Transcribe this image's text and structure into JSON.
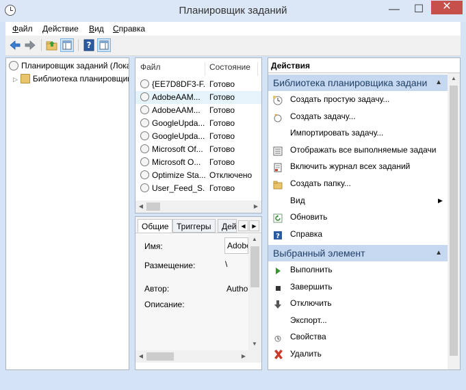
{
  "window": {
    "title": "Планировщик заданий",
    "minimize": "—",
    "maximize": "☐",
    "close": "✕",
    "app_icon": "clock-icon"
  },
  "menu": [
    "Файл",
    "Действие",
    "Вид",
    "Справка"
  ],
  "menu_underline": [
    "Ф",
    "Д",
    "В",
    "С"
  ],
  "menu_rest": [
    "айл",
    "ействие",
    "ид",
    "правка"
  ],
  "toolbar": {
    "icons": [
      "back-arrow-icon",
      "forward-arrow-icon",
      "folder-up-icon",
      "show-hide-tree-icon",
      "help-icon",
      "show-hide-action-pane-icon"
    ]
  },
  "tree": {
    "root": "Планировщик заданий (Локальный)",
    "child": "Библиотека планировщика заданий",
    "expander": "▷"
  },
  "tasks": {
    "col_file": "Файл",
    "col_status": "Состояние",
    "rows": [
      {
        "name": "{EE7D8DF3-F...",
        "status": "Готово"
      },
      {
        "name": "AdobeAAM...",
        "status": "Готово"
      },
      {
        "name": "AdobeAAM...",
        "status": "Готово"
      },
      {
        "name": "GoogleUpda...",
        "status": "Готово"
      },
      {
        "name": "GoogleUpda...",
        "status": "Готово"
      },
      {
        "name": "Microsoft Of...",
        "status": "Готово"
      },
      {
        "name": "Microsoft O...",
        "status": "Готово"
      },
      {
        "name": "Optimize Sta...",
        "status": "Отключено"
      },
      {
        "name": "User_Feed_S...",
        "status": "Готово"
      }
    ],
    "selected_index": 1
  },
  "details": {
    "tabs": [
      "Общие",
      "Триггеры",
      "Дей"
    ],
    "labels": [
      "Имя:",
      "Размещение:",
      "Автор:",
      "Описание:"
    ],
    "values": [
      "Adobe",
      "\\",
      "Autho",
      ""
    ],
    "nav_left": "◀",
    "nav_right": "▶"
  },
  "actions": {
    "header": "Действия",
    "section1": "Библиотека планировщика заданий",
    "section1_items": [
      {
        "label": "Создать простую задачу...",
        "icon": "create-basic-task-icon"
      },
      {
        "label": "Создать задачу...",
        "icon": "create-task-icon"
      },
      {
        "label": "Импортировать задачу...",
        "icon": ""
      },
      {
        "label": "Отображать все выполняемые задачи",
        "icon": "display-running-icon"
      },
      {
        "label": "Включить журнал всех заданий",
        "icon": "enable-history-icon"
      },
      {
        "label": "Создать папку...",
        "icon": "new-folder-icon"
      },
      {
        "label": "Вид",
        "icon": ""
      },
      {
        "label": "Обновить",
        "icon": "refresh-icon"
      },
      {
        "label": "Справка",
        "icon": "help-icon"
      }
    ],
    "section2": "Выбранный элемент",
    "section2_items": [
      {
        "label": "Выполнить",
        "icon": "run-icon"
      },
      {
        "label": "Завершить",
        "icon": "end-icon"
      },
      {
        "label": "Отключить",
        "icon": "disable-icon"
      },
      {
        "label": "Экспорт...",
        "icon": ""
      },
      {
        "label": "Свойства",
        "icon": "properties-icon"
      },
      {
        "label": "Удалить",
        "icon": "delete-icon"
      }
    ],
    "collapse_arrow": "▲",
    "submenu_arrow": "▶"
  },
  "colors": {
    "accent_header": "#c5d8ef",
    "selected_row": "#e5f3fb",
    "close_button": "#c7504b"
  }
}
